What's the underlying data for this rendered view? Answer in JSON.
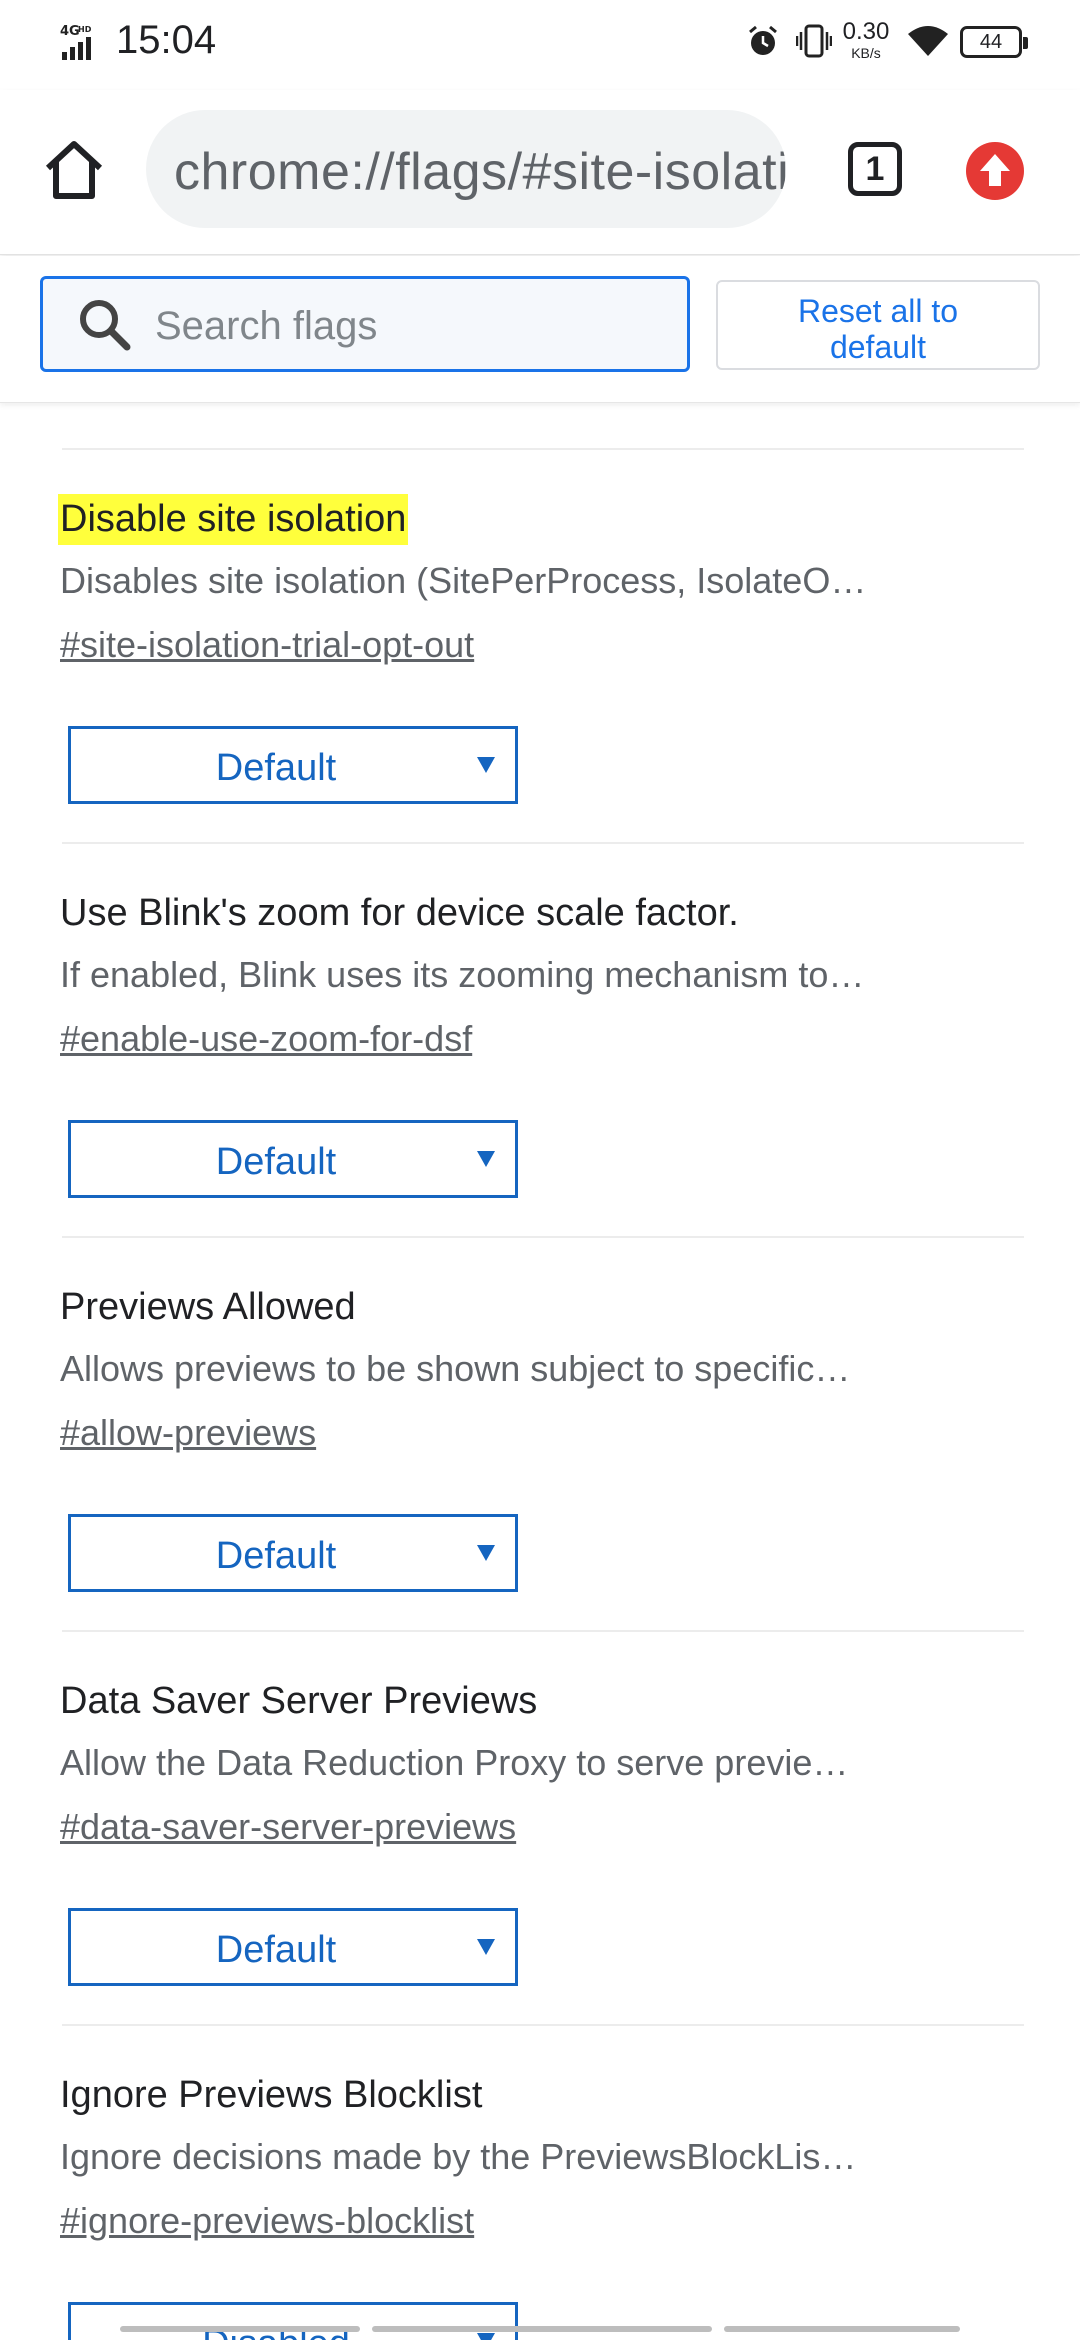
{
  "status_bar": {
    "network": "4GHD",
    "time": "15:04",
    "speed_value": "0.30",
    "speed_unit": "KB/s",
    "battery": "44"
  },
  "toolbar": {
    "url": "chrome://flags/#site-isolation-trial-opt-out",
    "tab_count": "1",
    "icons": [
      "home-icon",
      "tab-switcher-icon",
      "update-icon"
    ],
    "update_color": "#e53935"
  },
  "search": {
    "placeholder": "Search flags",
    "value": "",
    "reset_label_1": "Reset all to",
    "reset_label_2": "default"
  },
  "flags": [
    {
      "title": "Disable site isolation",
      "highlighted": true,
      "description": "Disables site isolation (SitePerProcess, IsolateO…",
      "link": "#site-isolation-trial-opt-out",
      "value": "Default"
    },
    {
      "title": "Use Blink's zoom for device scale factor.",
      "highlighted": false,
      "description": "If enabled, Blink uses its zooming mechanism to…",
      "link": "#enable-use-zoom-for-dsf",
      "value": "Default"
    },
    {
      "title": "Previews Allowed",
      "highlighted": false,
      "description": "Allows previews to be shown subject to specific…",
      "link": "#allow-previews",
      "value": "Default"
    },
    {
      "title": "Data Saver Server Previews",
      "highlighted": false,
      "description": "Allow the Data Reduction Proxy to serve previe…",
      "link": "#data-saver-server-previews",
      "value": "Default"
    },
    {
      "title": "Ignore Previews Blocklist",
      "highlighted": false,
      "description": "Ignore decisions made by the PreviewsBlockLis…",
      "link": "#ignore-previews-blocklist",
      "value": "Disabled"
    }
  ],
  "colors": {
    "accent": "#1a73e8",
    "select_blue": "#1565c0",
    "highlight": "#ffff3c"
  }
}
